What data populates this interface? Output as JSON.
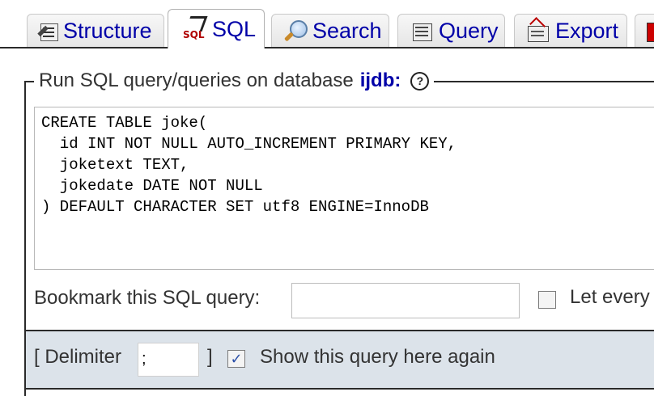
{
  "tabs": [
    {
      "label": "Structure",
      "icon": "structure-icon",
      "active": false
    },
    {
      "label": "SQL",
      "icon": "sql-icon",
      "active": true
    },
    {
      "label": "Search",
      "icon": "search-icon",
      "active": false
    },
    {
      "label": "Query",
      "icon": "query-icon",
      "active": false
    },
    {
      "label": "Export",
      "icon": "export-icon",
      "active": false
    }
  ],
  "panel": {
    "legend_text": "Run SQL query/queries on database",
    "database_name": "ijdb:",
    "help_icon": "?"
  },
  "sql_query": "CREATE TABLE joke(\n  id INT NOT NULL AUTO_INCREMENT PRIMARY KEY,\n  joketext TEXT,\n  jokedate DATE NOT NULL\n) DEFAULT CHARACTER SET utf8 ENGINE=InnoDB",
  "bookmark": {
    "label": "Bookmark this SQL query:",
    "value": "",
    "let_every_label": "Let every",
    "let_every_checked": false
  },
  "options": {
    "delimiter_open": "[ Delimiter",
    "delimiter_value": ";",
    "delimiter_close": "]",
    "show_query_label": "Show this query here again",
    "show_query_checked": true
  },
  "colors": {
    "tab_text": "#0000a8",
    "options_bar": "#dce3ea"
  }
}
